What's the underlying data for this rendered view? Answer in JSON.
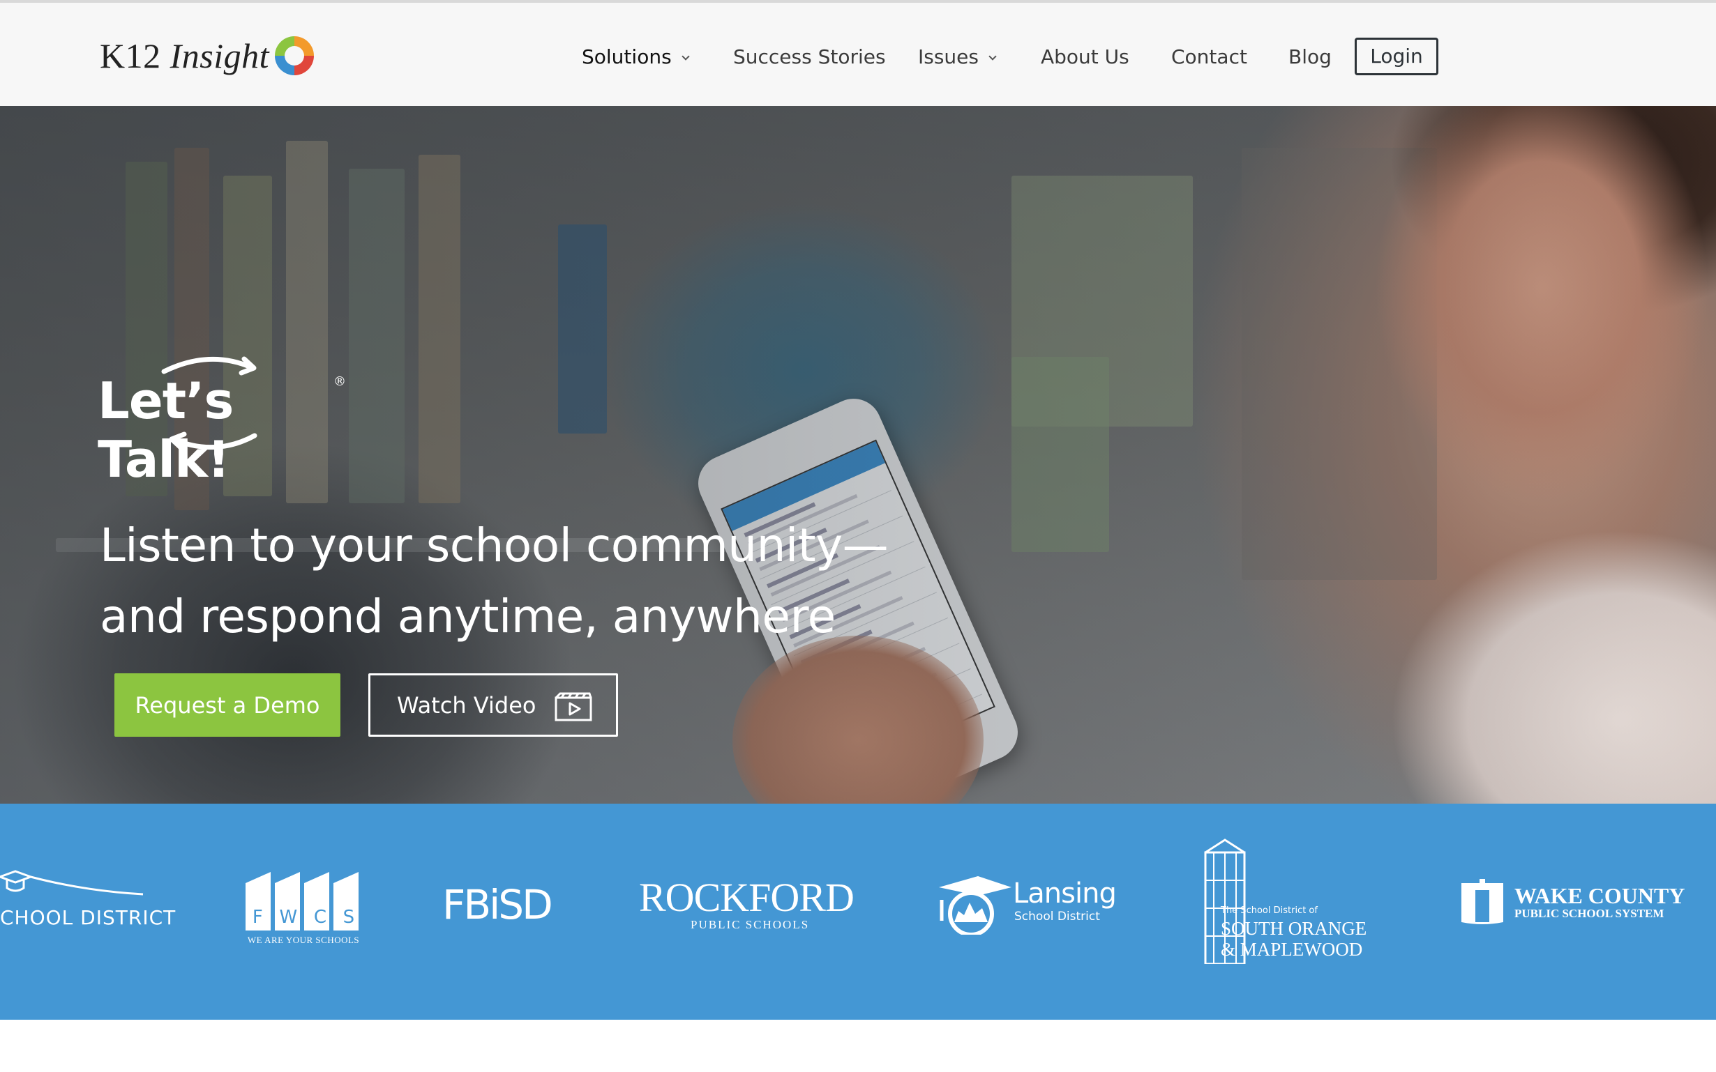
{
  "brand": {
    "name_part1": "K12",
    "name_part2": "Insight"
  },
  "nav": {
    "items": [
      {
        "label": "Solutions",
        "dropdown": true
      },
      {
        "label": "Success Stories",
        "dropdown": false
      },
      {
        "label": "Issues",
        "dropdown": true
      },
      {
        "label": "About Us",
        "dropdown": false
      },
      {
        "label": "Contact",
        "dropdown": false
      },
      {
        "label": "Blog",
        "dropdown": false
      }
    ],
    "login_label": "Login"
  },
  "hero": {
    "product_logo": "Let’s Talk!",
    "product_logo_mark": "®",
    "headline_line1": "Listen to your school community—",
    "headline_line2": "and respond anytime, anywhere",
    "cta_demo": "Request a Demo",
    "cta_video": "Watch Video"
  },
  "district_logos": {
    "partial": "CHOOL DISTRICT",
    "fwcs": {
      "letters": [
        "F",
        "W",
        "C",
        "S"
      ],
      "tagline": "WE ARE YOUR SCHOOLS"
    },
    "fbisd": "FBiSD",
    "rockford": {
      "name": "ROCKFORD",
      "sub": "PUBLIC SCHOOLS"
    },
    "lansing": {
      "name": "Lansing",
      "sub": "School District"
    },
    "south_orange": {
      "pre": "The School District of",
      "line1": "SOUTH ORANGE",
      "line2": "& MAPLEWOOD"
    },
    "wake": {
      "line1": "WAKE COUNTY",
      "line2": "PUBLIC SCHOOL SYSTEM"
    }
  },
  "colors": {
    "accent_green": "#8cc540",
    "strip_blue": "#4497d4",
    "header_bg": "#f7f7f7"
  }
}
